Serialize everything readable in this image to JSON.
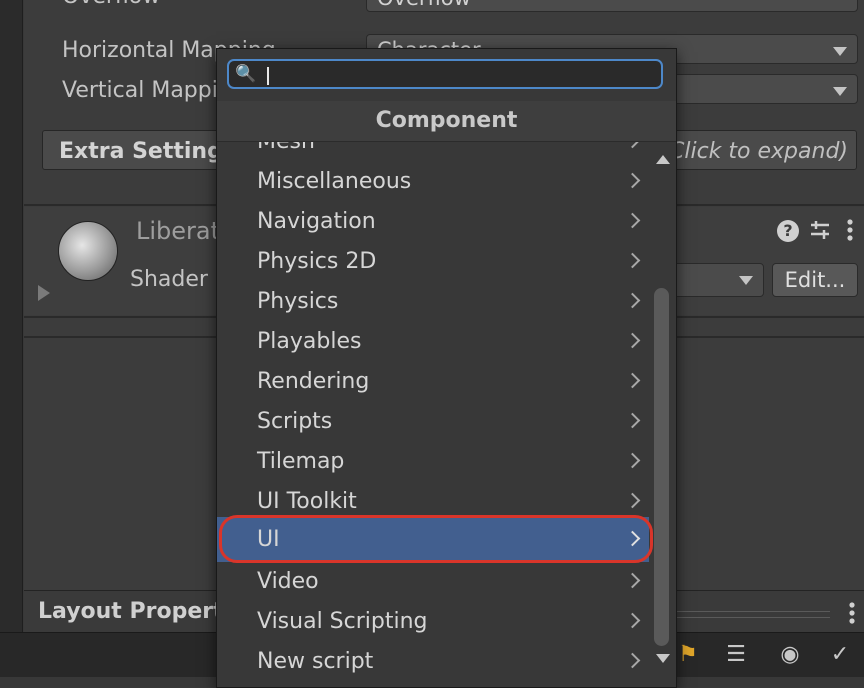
{
  "inspector": {
    "overflow_label": "Overflow",
    "overflow_value": "Overflow",
    "horizontal_mapping_label": "Horizontal Mapping",
    "horizontal_mapping_value": "Character",
    "vertical_mapping_label": "Vertical Mapping",
    "extra_settings_label": "Extra Settings",
    "extra_settings_hint": "(Click to expand)",
    "material_name": "LiberationSans SDF Material",
    "shader_label": "Shader",
    "edit_button": "Edit...",
    "help_icon": "?",
    "layout_properties_label": "Layout Properties"
  },
  "popup": {
    "search_value": "",
    "header": "Component",
    "items": [
      {
        "label": "Mesh",
        "selected": false
      },
      {
        "label": "Miscellaneous",
        "selected": false
      },
      {
        "label": "Navigation",
        "selected": false
      },
      {
        "label": "Physics 2D",
        "selected": false
      },
      {
        "label": "Physics",
        "selected": false
      },
      {
        "label": "Playables",
        "selected": false
      },
      {
        "label": "Rendering",
        "selected": false
      },
      {
        "label": "Scripts",
        "selected": false
      },
      {
        "label": "Tilemap",
        "selected": false
      },
      {
        "label": "UI Toolkit",
        "selected": false
      },
      {
        "label": "UI",
        "selected": true
      },
      {
        "label": "Video",
        "selected": false
      },
      {
        "label": "Visual Scripting",
        "selected": false
      },
      {
        "label": "New script",
        "selected": false
      }
    ]
  },
  "colors": {
    "selection": "#425f8f",
    "highlight_ring": "#d9352a",
    "search_focus": "#4d88c9"
  }
}
